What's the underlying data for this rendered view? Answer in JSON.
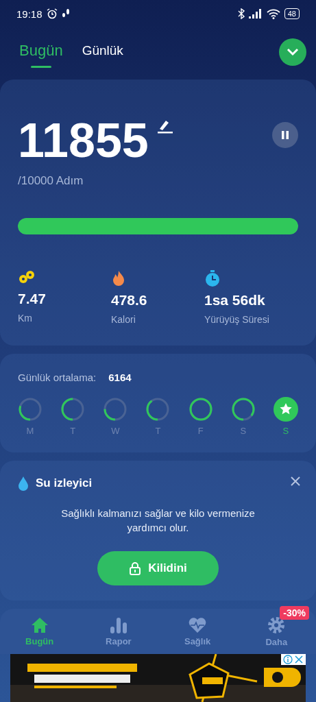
{
  "status_bar": {
    "time": "19:18",
    "battery": "48"
  },
  "tabs": [
    {
      "label": "Bugün",
      "selected": true
    },
    {
      "label": "Günlük",
      "selected": false
    }
  ],
  "steps": {
    "count": "11855",
    "goal": "/10000 Adım",
    "level": 1.0
  },
  "stats": [
    {
      "kind": "distance",
      "value": "7.47",
      "label": "Km"
    },
    {
      "kind": "calories",
      "value": "478.6",
      "label": "Kalori"
    },
    {
      "kind": "duration",
      "value": "1sa 56dk",
      "label": "Yürüyüş Süresi"
    }
  ],
  "average": {
    "label": "Günlük ortalama:",
    "value": "6164"
  },
  "week": [
    {
      "day": "M",
      "achieved": false
    },
    {
      "day": "T",
      "achieved": false
    },
    {
      "day": "W",
      "achieved": false
    },
    {
      "day": "T",
      "achieved": false
    },
    {
      "day": "F",
      "achieved": false
    },
    {
      "day": "S",
      "achieved": false
    },
    {
      "day": "S",
      "achieved": true
    }
  ],
  "water": {
    "title": "Su izleyici",
    "text": "Sağlıklı kalmanızı sağlar ve kilo vermenize yardımcı olur.",
    "button": "Kilidini"
  },
  "nav": [
    {
      "kind": "home",
      "label": "Bugün",
      "selected": true
    },
    {
      "kind": "report",
      "label": "Rapor",
      "selected": false
    },
    {
      "kind": "health",
      "label": "Sağlık",
      "selected": false
    },
    {
      "kind": "more",
      "label": "Daha",
      "selected": false,
      "badge": "-30%"
    }
  ]
}
